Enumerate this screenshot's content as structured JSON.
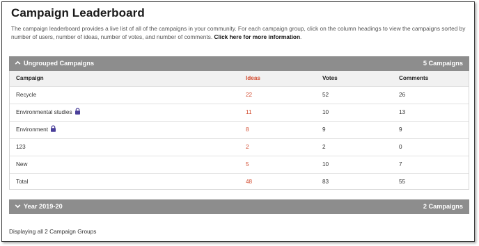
{
  "page": {
    "title": "Campaign Leaderboard",
    "description": "The campaign leaderboard provides a live list of all of the campaigns in your community. For each campaign group, click on the column headings to view the campaigns sorted by number of users, number of ideas, number of votes, and number of comments.",
    "more_link": "Click here for more information",
    "period": "."
  },
  "groups": [
    {
      "name": "Ungrouped Campaigns",
      "count": "5 Campaigns",
      "expanded": true,
      "chevron": "chevron-up-icon"
    },
    {
      "name": "Year 2019-20",
      "count": "2 Campaigns",
      "expanded": false,
      "chevron": "chevron-down-icon"
    }
  ],
  "table": {
    "headers": {
      "campaign": "Campaign",
      "ideas": "Ideas",
      "votes": "Votes",
      "comments": "Comments"
    },
    "rows": [
      {
        "campaign": "Recycle",
        "ideas": "22",
        "votes": "52",
        "comments": "26",
        "locked": false
      },
      {
        "campaign": "Environmental studies",
        "ideas": "11",
        "votes": "10",
        "comments": "13",
        "locked": true
      },
      {
        "campaign": "Environment",
        "ideas": "8",
        "votes": "9",
        "comments": "9",
        "locked": true
      },
      {
        "campaign": "123",
        "ideas": "2",
        "votes": "2",
        "comments": "0",
        "locked": false
      },
      {
        "campaign": "New",
        "ideas": "5",
        "votes": "10",
        "comments": "7",
        "locked": false
      },
      {
        "campaign": "Total",
        "ideas": "48",
        "votes": "83",
        "comments": "55",
        "locked": false
      }
    ]
  },
  "footer": "Displaying all 2 Campaign Groups",
  "colors": {
    "accent": "#d24a2e",
    "group_bar": "#8d8d8d",
    "lock": "#4a3f9a"
  }
}
